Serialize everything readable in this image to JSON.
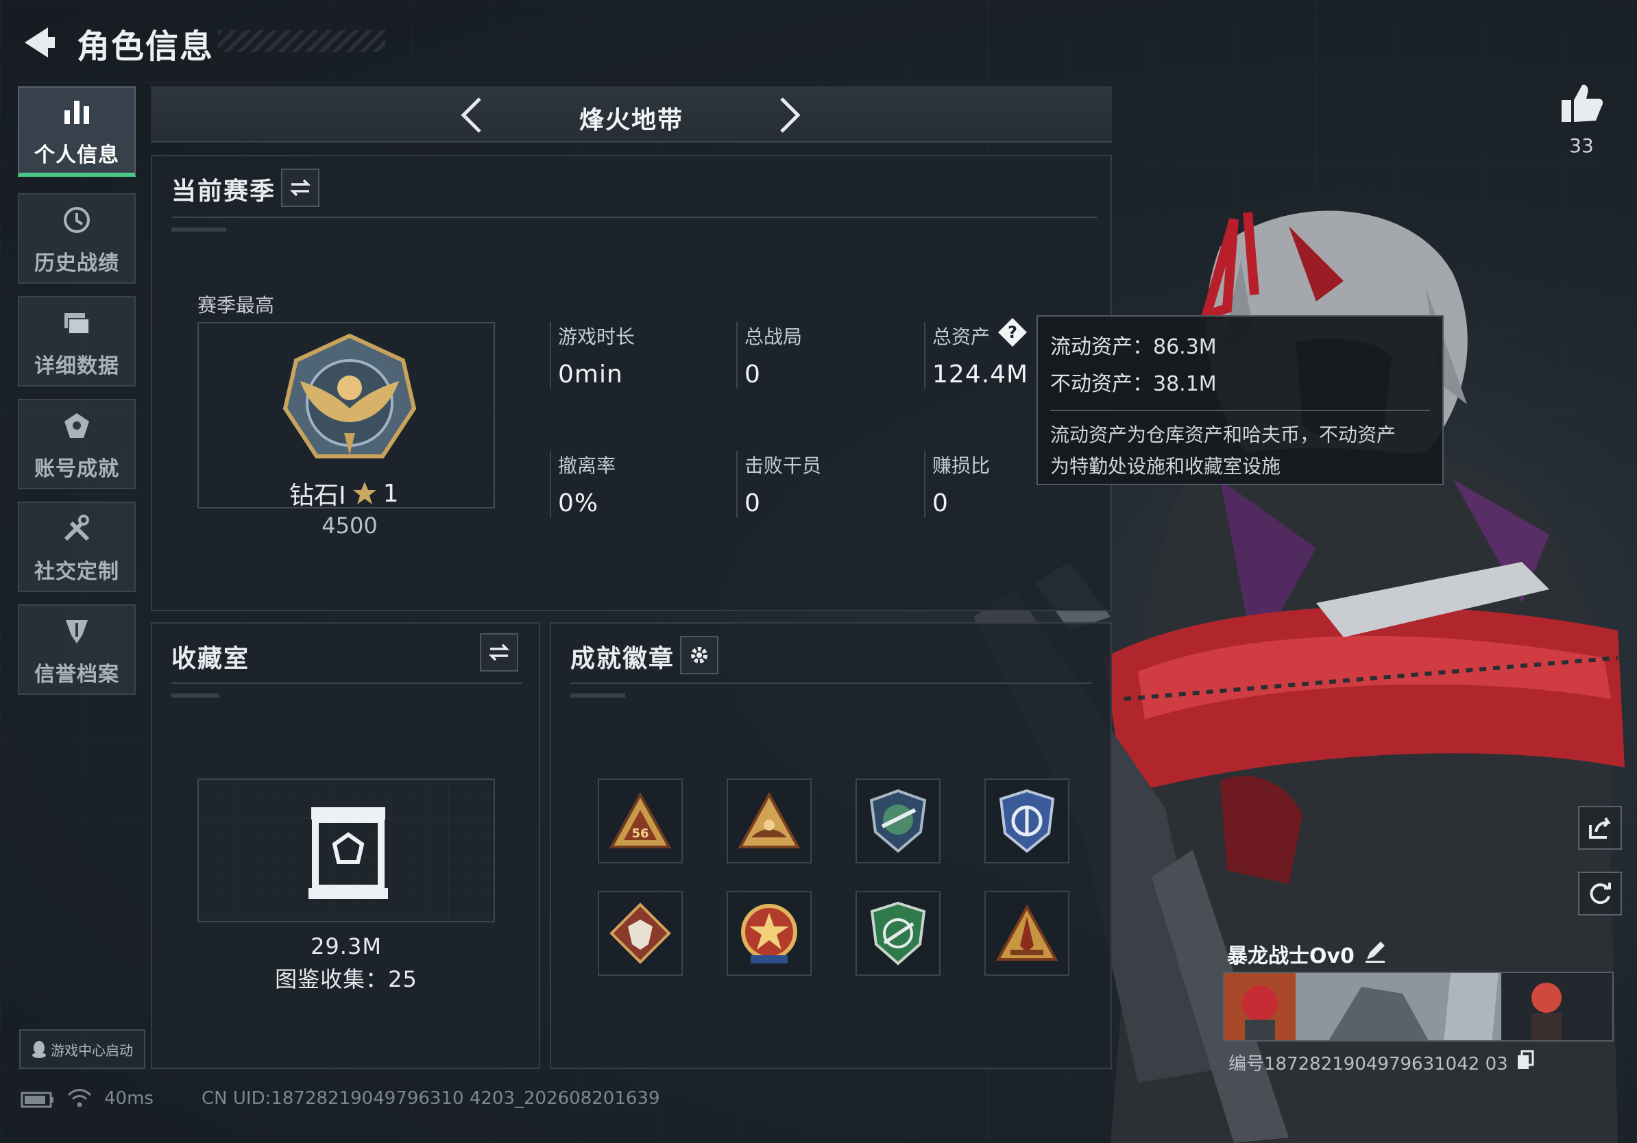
{
  "header": {
    "title": "角色信息"
  },
  "nav": {
    "items": [
      {
        "label": "个人信息",
        "icon": "bar-chart-icon",
        "active": true
      },
      {
        "label": "历史战绩",
        "icon": "history-clock-icon",
        "active": false
      },
      {
        "label": "详细数据",
        "icon": "folder-icon",
        "active": false
      },
      {
        "label": "账号成就",
        "icon": "achievement-icon",
        "active": false
      },
      {
        "label": "社交定制",
        "icon": "tools-icon",
        "active": false
      },
      {
        "label": "信誉档案",
        "icon": "credit-shield-icon",
        "active": false
      }
    ]
  },
  "mode": {
    "title": "烽火地带"
  },
  "season": {
    "title": "当前赛季",
    "best_label": "赛季最高",
    "rank_name": "钻石Ⅰ",
    "rank_stars": "1",
    "rank_score": "4500",
    "stats": [
      {
        "label": "游戏时长",
        "value": "0min"
      },
      {
        "label": "总战局",
        "value": "0"
      },
      {
        "label": "总资产",
        "value": "124.4M"
      },
      {
        "label": "撤离率",
        "value": "0%"
      },
      {
        "label": "击败干员",
        "value": "0"
      },
      {
        "label": "赚损比",
        "value": "0"
      }
    ]
  },
  "tooltip": {
    "liquid": "流动资产：86.3M",
    "fixed": "不动资产：38.1M",
    "desc_line1": "流动资产为仓库资产和哈夫币，不动资产",
    "desc_line2": "为特勤处设施和收藏室设施"
  },
  "collection": {
    "title": "收藏室",
    "value": "29.3M",
    "catalog": "图鉴收集：25"
  },
  "badges": {
    "title": "成就徽章",
    "items": [
      "triangle-56-badge",
      "triangle-wings-badge",
      "shield-rifle-badge",
      "blue-shield-badge",
      "wolf-diamond-badge",
      "star-medal-badge",
      "green-shield-badge",
      "triangle-rocket-badge"
    ]
  },
  "profile": {
    "likes": "33",
    "name": "暴龙战士Ov0",
    "id_text": "编号1872821904979631042 03"
  },
  "footer": {
    "game_center": "游戏中心启动",
    "ping": "40ms",
    "uid": "CN UID:18728219049796310 4203_202608201639"
  },
  "colors": {
    "accent": "#49c889",
    "panel": "#1c232a",
    "text": "#e4e8ec"
  }
}
